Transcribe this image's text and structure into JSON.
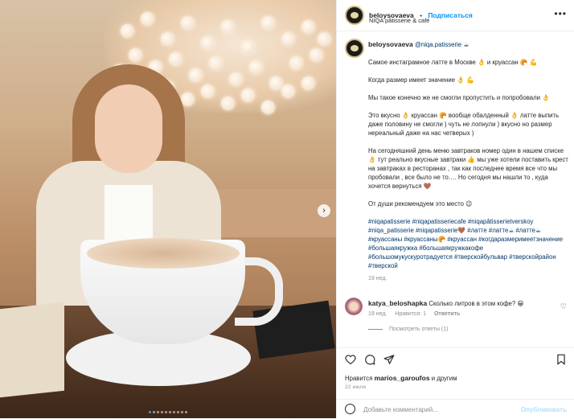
{
  "header": {
    "username": "beloysovaeva",
    "dot": "•",
    "follow_label": "Подписаться",
    "subtitle": "NIQA pâtisserie & café",
    "more_icon": "more-dots-icon"
  },
  "post": {
    "author": "beloysovaeva",
    "mention": "@niqa.patisserie",
    "lines": [
      "Самое инстаграмное латте в Москве 👌 и круассан 🥐 💪",
      "",
      "Когда размер имеет значение 👌 💪",
      "",
      "Мы такое конечно же не смогли пропустить и попробовали 👌",
      "",
      "Это вкусно 👌 круассан 🥐 вообще обалденный 👌 латте выпить даже половину не смогли ) чуть не лопнули ) вкусно но размер нереальный даже на нас четверых )",
      "",
      "На сегодняшний день меню завтраков номер один в нашем списке 👌 тут реально вкусные завтраки 👍 мы уже хотели поставить крест на завтраках в ресторанах , так как последнее время все что мы пробовали , все было не то…. Но сегодня мы нашли то , куда хочется вернуться 🤎",
      "",
      "От души рекомендуем это место 😉",
      ""
    ],
    "hashtags": "#niqapatisserie #niqapatisseriecafe #niqapâtisserietverskoy #niqa_patisserie #niqapatisserie🤎 #латте #латте☕ #латте☕ #круассаны #круассаны🥐 #круассан #когдаразмеримеетзначение #большаякружка #большаякружкакофе #большомукускуротрадуется #тверскойбульвар #тверскойрайон #тверской",
    "age": "19 нед."
  },
  "comment": {
    "username": "katya_beloshapka",
    "text": "Сколько литров в этом кофе? 😁",
    "age": "19 нед.",
    "likes": "Нравится: 1",
    "reply": "Ответить",
    "view_replies": "Посмотреть ответы (1)"
  },
  "likes_text": {
    "prefix": "Нравится",
    "user": "marios_garoufos",
    "suffix": "и другим"
  },
  "time_ago": "22 июля",
  "add_comment": {
    "placeholder": "Добавьте комментарий...",
    "publish": "Опубликовать"
  },
  "carousel": {
    "total": 10,
    "active": 1
  },
  "colors": {
    "link": "#0095f6",
    "hashtag": "#00376b",
    "muted": "#8e8e8e"
  }
}
